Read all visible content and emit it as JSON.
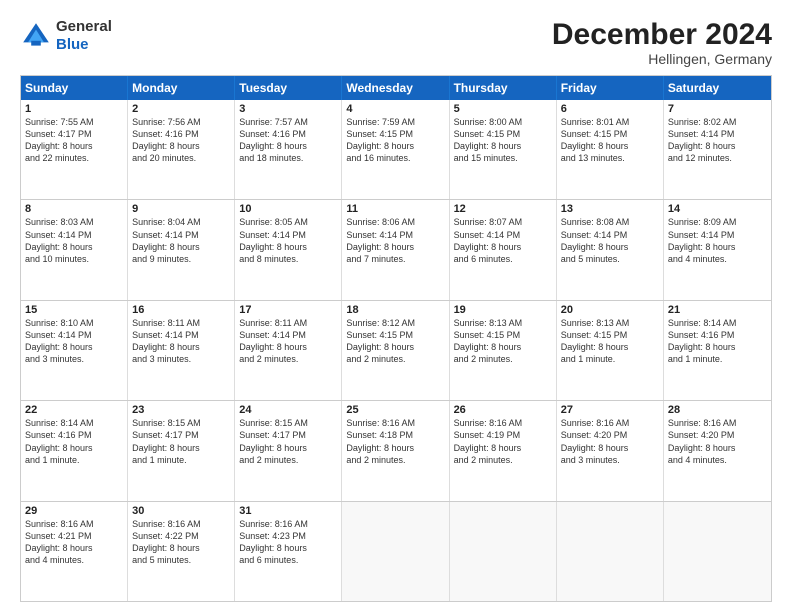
{
  "header": {
    "logo_general": "General",
    "logo_blue": "Blue",
    "title": "December 2024",
    "location": "Hellingen, Germany"
  },
  "weekdays": [
    "Sunday",
    "Monday",
    "Tuesday",
    "Wednesday",
    "Thursday",
    "Friday",
    "Saturday"
  ],
  "rows": [
    [
      {
        "day": "1",
        "lines": [
          "Sunrise: 7:55 AM",
          "Sunset: 4:17 PM",
          "Daylight: 8 hours",
          "and 22 minutes."
        ]
      },
      {
        "day": "2",
        "lines": [
          "Sunrise: 7:56 AM",
          "Sunset: 4:16 PM",
          "Daylight: 8 hours",
          "and 20 minutes."
        ]
      },
      {
        "day": "3",
        "lines": [
          "Sunrise: 7:57 AM",
          "Sunset: 4:16 PM",
          "Daylight: 8 hours",
          "and 18 minutes."
        ]
      },
      {
        "day": "4",
        "lines": [
          "Sunrise: 7:59 AM",
          "Sunset: 4:15 PM",
          "Daylight: 8 hours",
          "and 16 minutes."
        ]
      },
      {
        "day": "5",
        "lines": [
          "Sunrise: 8:00 AM",
          "Sunset: 4:15 PM",
          "Daylight: 8 hours",
          "and 15 minutes."
        ]
      },
      {
        "day": "6",
        "lines": [
          "Sunrise: 8:01 AM",
          "Sunset: 4:15 PM",
          "Daylight: 8 hours",
          "and 13 minutes."
        ]
      },
      {
        "day": "7",
        "lines": [
          "Sunrise: 8:02 AM",
          "Sunset: 4:14 PM",
          "Daylight: 8 hours",
          "and 12 minutes."
        ]
      }
    ],
    [
      {
        "day": "8",
        "lines": [
          "Sunrise: 8:03 AM",
          "Sunset: 4:14 PM",
          "Daylight: 8 hours",
          "and 10 minutes."
        ]
      },
      {
        "day": "9",
        "lines": [
          "Sunrise: 8:04 AM",
          "Sunset: 4:14 PM",
          "Daylight: 8 hours",
          "and 9 minutes."
        ]
      },
      {
        "day": "10",
        "lines": [
          "Sunrise: 8:05 AM",
          "Sunset: 4:14 PM",
          "Daylight: 8 hours",
          "and 8 minutes."
        ]
      },
      {
        "day": "11",
        "lines": [
          "Sunrise: 8:06 AM",
          "Sunset: 4:14 PM",
          "Daylight: 8 hours",
          "and 7 minutes."
        ]
      },
      {
        "day": "12",
        "lines": [
          "Sunrise: 8:07 AM",
          "Sunset: 4:14 PM",
          "Daylight: 8 hours",
          "and 6 minutes."
        ]
      },
      {
        "day": "13",
        "lines": [
          "Sunrise: 8:08 AM",
          "Sunset: 4:14 PM",
          "Daylight: 8 hours",
          "and 5 minutes."
        ]
      },
      {
        "day": "14",
        "lines": [
          "Sunrise: 8:09 AM",
          "Sunset: 4:14 PM",
          "Daylight: 8 hours",
          "and 4 minutes."
        ]
      }
    ],
    [
      {
        "day": "15",
        "lines": [
          "Sunrise: 8:10 AM",
          "Sunset: 4:14 PM",
          "Daylight: 8 hours",
          "and 3 minutes."
        ]
      },
      {
        "day": "16",
        "lines": [
          "Sunrise: 8:11 AM",
          "Sunset: 4:14 PM",
          "Daylight: 8 hours",
          "and 3 minutes."
        ]
      },
      {
        "day": "17",
        "lines": [
          "Sunrise: 8:11 AM",
          "Sunset: 4:14 PM",
          "Daylight: 8 hours",
          "and 2 minutes."
        ]
      },
      {
        "day": "18",
        "lines": [
          "Sunrise: 8:12 AM",
          "Sunset: 4:15 PM",
          "Daylight: 8 hours",
          "and 2 minutes."
        ]
      },
      {
        "day": "19",
        "lines": [
          "Sunrise: 8:13 AM",
          "Sunset: 4:15 PM",
          "Daylight: 8 hours",
          "and 2 minutes."
        ]
      },
      {
        "day": "20",
        "lines": [
          "Sunrise: 8:13 AM",
          "Sunset: 4:15 PM",
          "Daylight: 8 hours",
          "and 1 minute."
        ]
      },
      {
        "day": "21",
        "lines": [
          "Sunrise: 8:14 AM",
          "Sunset: 4:16 PM",
          "Daylight: 8 hours",
          "and 1 minute."
        ]
      }
    ],
    [
      {
        "day": "22",
        "lines": [
          "Sunrise: 8:14 AM",
          "Sunset: 4:16 PM",
          "Daylight: 8 hours",
          "and 1 minute."
        ]
      },
      {
        "day": "23",
        "lines": [
          "Sunrise: 8:15 AM",
          "Sunset: 4:17 PM",
          "Daylight: 8 hours",
          "and 1 minute."
        ]
      },
      {
        "day": "24",
        "lines": [
          "Sunrise: 8:15 AM",
          "Sunset: 4:17 PM",
          "Daylight: 8 hours",
          "and 2 minutes."
        ]
      },
      {
        "day": "25",
        "lines": [
          "Sunrise: 8:16 AM",
          "Sunset: 4:18 PM",
          "Daylight: 8 hours",
          "and 2 minutes."
        ]
      },
      {
        "day": "26",
        "lines": [
          "Sunrise: 8:16 AM",
          "Sunset: 4:19 PM",
          "Daylight: 8 hours",
          "and 2 minutes."
        ]
      },
      {
        "day": "27",
        "lines": [
          "Sunrise: 8:16 AM",
          "Sunset: 4:20 PM",
          "Daylight: 8 hours",
          "and 3 minutes."
        ]
      },
      {
        "day": "28",
        "lines": [
          "Sunrise: 8:16 AM",
          "Sunset: 4:20 PM",
          "Daylight: 8 hours",
          "and 4 minutes."
        ]
      }
    ],
    [
      {
        "day": "29",
        "lines": [
          "Sunrise: 8:16 AM",
          "Sunset: 4:21 PM",
          "Daylight: 8 hours",
          "and 4 minutes."
        ]
      },
      {
        "day": "30",
        "lines": [
          "Sunrise: 8:16 AM",
          "Sunset: 4:22 PM",
          "Daylight: 8 hours",
          "and 5 minutes."
        ]
      },
      {
        "day": "31",
        "lines": [
          "Sunrise: 8:16 AM",
          "Sunset: 4:23 PM",
          "Daylight: 8 hours",
          "and 6 minutes."
        ]
      },
      {
        "day": "",
        "lines": []
      },
      {
        "day": "",
        "lines": []
      },
      {
        "day": "",
        "lines": []
      },
      {
        "day": "",
        "lines": []
      }
    ]
  ]
}
